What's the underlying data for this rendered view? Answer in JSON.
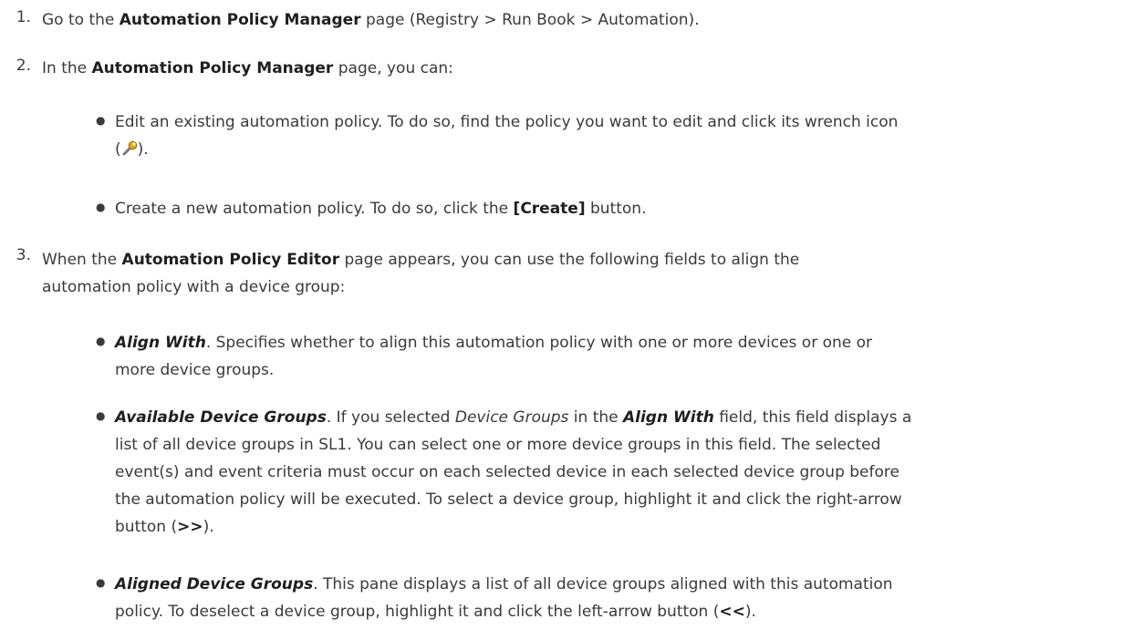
{
  "step1": {
    "num": "1.",
    "pre": "Go to the ",
    "bold": "Automation Policy Manager",
    "post": " page (Registry > Run Book > Automation)."
  },
  "step2": {
    "num": "2.",
    "pre": "In the ",
    "bold": "Automation Policy Manager",
    "post": " page, you can:",
    "bullets": [
      {
        "text1": "Edit an existing automation policy. To do so, find the policy you want to edit and click its wrench icon",
        "open": "(",
        "icon": "wrench-icon",
        "close": ")."
      },
      {
        "pre": "Create a new automation policy. To do so, click the ",
        "bold": "[Create]",
        "post": " button."
      }
    ]
  },
  "step3": {
    "num": "3.",
    "pre": "When the ",
    "bold": "Automation Policy Editor",
    "post1": " page appears, you can use the following fields to align the",
    "post2": "automation policy with a device group:",
    "bullets": [
      {
        "field": "Align With",
        "line1": ". Specifies whether to align this automation policy with one or more devices or one or",
        "line2": "more device groups."
      },
      {
        "field": "Available Device Groups",
        "a": ". If you selected ",
        "ital": "Device Groups",
        "b": " in the ",
        "field2": "Align With",
        "c": " field, this field displays a",
        "line2": "list of all device groups in SL1. You can select one or more device groups in this field. The selected",
        "line3": "event(s) and event criteria must occur on each selected device in each selected device group before",
        "line4a": "the automation policy will be executed. To select a device group, highlight it and click the right-arrow",
        "line5a": "button (",
        "arrow": ">>",
        "line5b": ")."
      },
      {
        "field": "Aligned Device Groups",
        "line1": ". This pane displays a list of all device groups aligned with this automation",
        "line2a": "policy. To deselect a device group, highlight it and click the left-arrow button (",
        "arrow": "<<",
        "line2b": ")."
      }
    ]
  }
}
